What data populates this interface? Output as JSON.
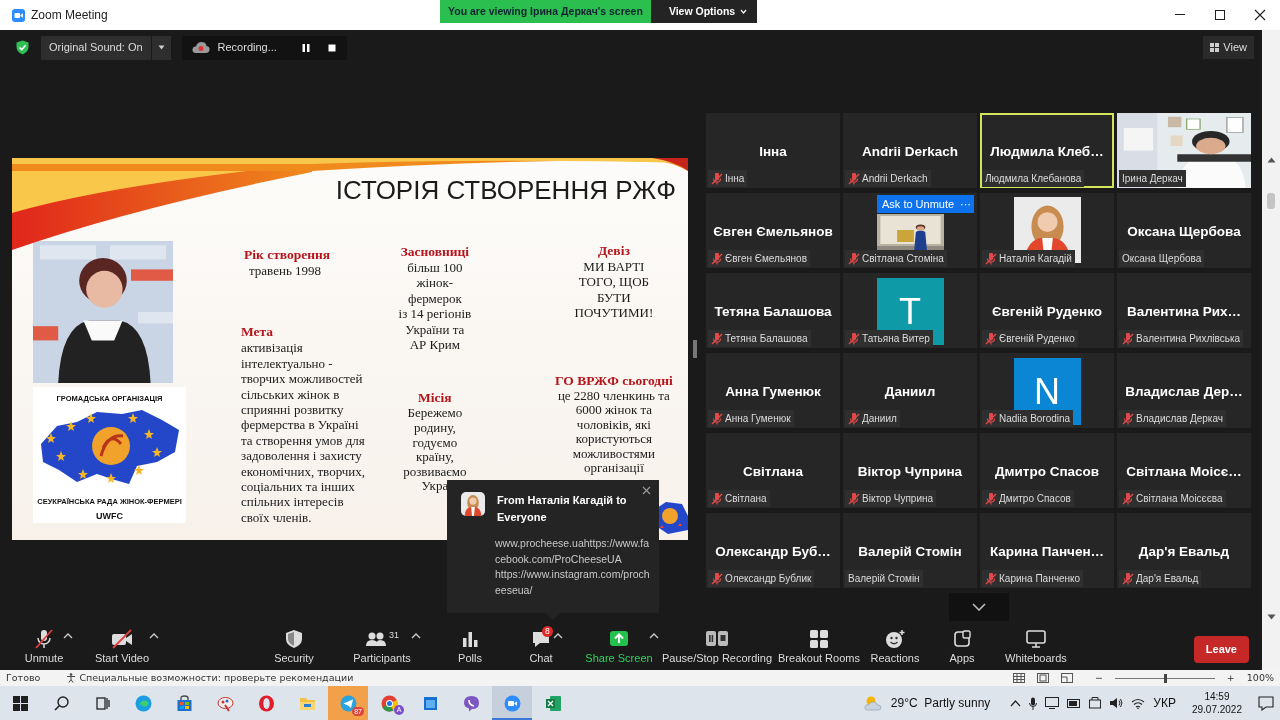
{
  "window": {
    "title": "Zoom Meeting",
    "banner": "You are viewing Ірина Деркач's screen",
    "view_options": "View Options"
  },
  "top_bar": {
    "original_sound": "Original Sound: On",
    "recording": "Recording...",
    "view": "View"
  },
  "slide": {
    "title": "ІСТОРІЯ СТВОРЕННЯ РЖФ",
    "columns": [
      [
        {
          "heading": "Рік створення",
          "body": "травень  1998"
        },
        {
          "heading": "Мета",
          "body": "активізація\nінтелектуально -\nтворчих  можливостей\nсільських  жінок в\nсприянні  розвитку\nфермерства в Україні\nта створення умов для\nзадоволення і захисту\nекономічних, творчих,\nсоціальних  та інших\nспільних інтересів\nсвоїх членів."
        }
      ],
      [
        {
          "heading": "Засновниці",
          "body": "більш  100\nжінок-\nфермерок\nіз 14  регіонів\nУкраїни   та\nАР Крим"
        },
        {
          "heading": "Місія",
          "body": "Бережемо\nродину,\nгодуємо\nкраїну,\nрозвиваємо\nУкра"
        }
      ],
      [
        {
          "heading": "Девіз",
          "body": "МИ ВАРТІ\nТОГО, ЩОБ\nБУТИ\nПОЧУТИМИ!"
        },
        {
          "heading": "ГО  ВРЖФ сьогодні",
          "body": "це  2280 членкинь  та\n6000 жінок та\nчоловіків, які\nкористуються\nможливостями\nорганізації"
        }
      ]
    ],
    "logo": {
      "top_text": "ГРОМАДСЬКА ОРГАНІЗАЦІЯ",
      "bottom_text": "СЕУКРАЇНСЬКА РАДА ЖІНОК-ФЕРМЕРІ",
      "caption": "UWFC"
    }
  },
  "gallery": {
    "tiles": [
      {
        "kind": "name",
        "display_name": "Інна",
        "label": "Інна",
        "muted": true,
        "speaking": false
      },
      {
        "kind": "name",
        "display_name": "Andrii Derkach",
        "label": "Andrii Derkach",
        "muted": true,
        "speaking": false
      },
      {
        "kind": "name",
        "display_name": "Людмила  Клеб…",
        "label": "Людмила Клебанова",
        "muted": false,
        "speaking": true
      },
      {
        "kind": "video",
        "label": "Ірина Деркач",
        "muted": false,
        "speaking": false
      },
      {
        "kind": "name",
        "display_name": "Євген Ємельянов",
        "label": "Євген Ємельянов",
        "muted": true,
        "speaking": false
      },
      {
        "label": "Світлана Стоміна",
        "muted": true,
        "speaking": false,
        "ask_button": "Ask to Unmute",
        "more_button": "···"
      },
      {
        "label": "Наталія Кагадій",
        "muted": true,
        "speaking": false
      },
      {
        "kind": "name",
        "display_name": "Оксана Щербова",
        "label": "Оксана Щербова",
        "muted": false,
        "speaking": false
      },
      {
        "kind": "name",
        "display_name": "Тетяна Балашова",
        "label": "Тетяна Балашова",
        "muted": true,
        "speaking": false
      },
      {
        "kind": "letter",
        "letter": "T",
        "color": "#0e9aa7",
        "label": "Татьяна Витер",
        "muted": true,
        "speaking": false
      },
      {
        "kind": "name",
        "display_name": "Євгеній Руденко",
        "label": "Євгеній Руденко",
        "muted": true,
        "speaking": false
      },
      {
        "kind": "name",
        "display_name": "Валентина  Рих…",
        "label": "Валентина Рихлівська",
        "muted": true,
        "speaking": false
      },
      {
        "kind": "name",
        "display_name": "Анна Гуменюк",
        "label": "Анна Гуменюк",
        "muted": true,
        "speaking": false
      },
      {
        "kind": "name",
        "display_name": "Даниил",
        "label": "Даниил",
        "muted": true,
        "speaking": false
      },
      {
        "kind": "letter",
        "letter": "N",
        "color": "#0b86d4",
        "label": "Nadiia Borodina",
        "muted": true,
        "speaking": false
      },
      {
        "kind": "name",
        "display_name": "Владислав  Дер…",
        "label": "Владислав Деркач",
        "muted": true,
        "speaking": false
      },
      {
        "kind": "name",
        "display_name": "Світлана",
        "label": "Світлана",
        "muted": true,
        "speaking": false
      },
      {
        "kind": "name",
        "display_name": "Віктор Чуприна",
        "label": "Віктор Чуприна",
        "muted": true,
        "speaking": false
      },
      {
        "kind": "name",
        "display_name": "Дмитро Спасов",
        "label": "Дмитро Спасов",
        "muted": true,
        "speaking": false
      },
      {
        "kind": "name",
        "display_name": "Світлана  Моісє…",
        "label": "Світлана Моісєєва",
        "muted": true,
        "speaking": false
      },
      {
        "kind": "name",
        "display_name": "Олександр  Буб…",
        "label": "Олександр Бублик",
        "muted": true,
        "speaking": false
      },
      {
        "kind": "name",
        "display_name": "Валерій Стомін",
        "label": "Валерій Стомін",
        "muted": false,
        "speaking": false
      },
      {
        "kind": "name",
        "display_name": "Карина  Панчен…",
        "label": "Карина Панченко",
        "muted": true,
        "speaking": false
      },
      {
        "kind": "name",
        "display_name": "Дар'я Евальд",
        "label": "Дар'я Евальд",
        "muted": true,
        "speaking": false
      }
    ]
  },
  "chat_popup": {
    "title": "From Наталія Кагадій to Everyone",
    "message": "www.procheese.uahttps://www.facebook.com/ProCheeseUA\nhttps://www.instagram.com/procheeseua/"
  },
  "toolbar": {
    "items": [
      {
        "kind": "mic",
        "label": "Unmute",
        "caret": true
      },
      {
        "kind": "video",
        "label": "Start Video",
        "caret": true
      },
      {
        "kind": "security",
        "label": "Security",
        "caret": false
      },
      {
        "kind": "participants",
        "label": "Participants",
        "count": "31",
        "caret": true
      },
      {
        "kind": "polls",
        "label": "Polls",
        "caret": false
      },
      {
        "kind": "chat",
        "label": "Chat",
        "badge": "8",
        "caret": true
      },
      {
        "kind": "share",
        "label": "Share Screen",
        "caret": true
      },
      {
        "kind": "record",
        "label": "Pause/Stop Recording",
        "caret": false
      },
      {
        "kind": "breakout",
        "label": "Breakout Rooms",
        "caret": false
      },
      {
        "kind": "reactions",
        "label": "Reactions",
        "caret": false
      },
      {
        "kind": "apps",
        "label": "Apps",
        "caret": false
      },
      {
        "kind": "whiteboards",
        "label": "Whiteboards",
        "caret": false
      }
    ],
    "leave": "Leave"
  },
  "status_bar": {
    "ready": "Готово",
    "accessibility": "Специальные возможности: проверьте рекомендации",
    "zoom_out": "−",
    "zoom_in": "+",
    "zoom_slider": {
      "level": 0.5
    },
    "zoom": "100%"
  },
  "taskbar": {
    "apps": [
      {
        "kind": "start",
        "selected": false,
        "flashing": false
      },
      {
        "kind": "search",
        "selected": false,
        "flashing": false
      },
      {
        "kind": "taskview",
        "selected": false,
        "flashing": false
      },
      {
        "kind": "edge",
        "selected": false,
        "flashing": false
      },
      {
        "kind": "store",
        "selected": false,
        "flashing": false
      },
      {
        "kind": "paint",
        "selected": false,
        "flashing": false
      },
      {
        "kind": "opera",
        "selected": false,
        "flashing": false
      },
      {
        "kind": "explorer",
        "selected": false,
        "flashing": false
      },
      {
        "kind": "telegram",
        "selected": false,
        "flashing": true,
        "badge": "87"
      },
      {
        "kind": "chrome",
        "selected": false,
        "flashing": false,
        "profile_letter": "A"
      },
      {
        "kind": "window",
        "selected": false,
        "flashing": false
      },
      {
        "kind": "viber",
        "selected": false,
        "flashing": false
      },
      {
        "kind": "zoom",
        "selected": true,
        "flashing": false
      },
      {
        "kind": "excel",
        "selected": false,
        "flashing": false
      }
    ],
    "weather": "29°C  Partly sunny",
    "language": "УКР",
    "time": "14:59",
    "date": "29.07.2022"
  }
}
